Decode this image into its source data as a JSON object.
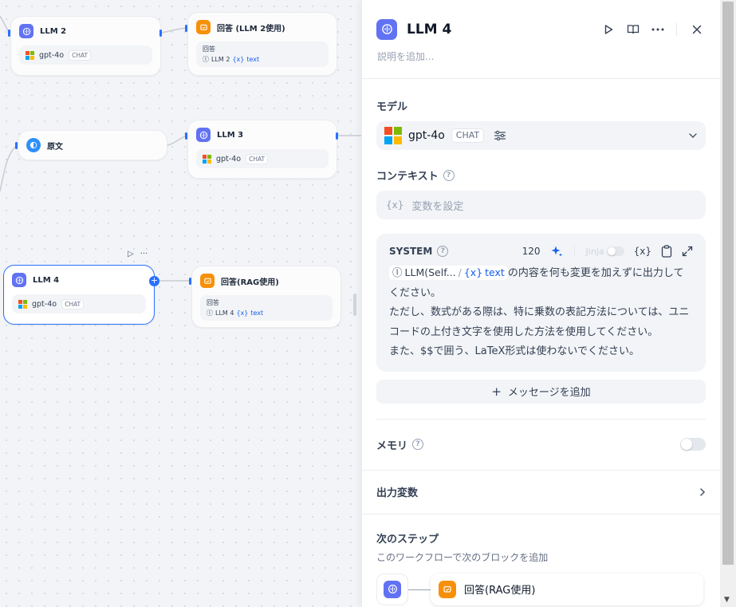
{
  "canvas": {
    "nodes": {
      "llm2": {
        "title": "LLM 2",
        "model": "gpt-4o",
        "mode": "CHAT"
      },
      "answer_llm2": {
        "title": "回答 (LLM 2使用)",
        "label": "回答",
        "ref_node": "LLM 2",
        "ref_var": "text"
      },
      "knowledge": {
        "title": "原文"
      },
      "llm3": {
        "title": "LLM 3",
        "model": "gpt-4o",
        "mode": "CHAT"
      },
      "llm4": {
        "title": "LLM 4",
        "model": "gpt-4o",
        "mode": "CHAT"
      },
      "answer_rag": {
        "title": "回答(RAG使用)",
        "label": "回答",
        "ref_node": "LLM 4",
        "ref_var": "text"
      }
    },
    "node_toolbar": {
      "run": "▷",
      "more": "···"
    }
  },
  "panel": {
    "title": "LLM 4",
    "description_placeholder": "説明を追加...",
    "model_section": {
      "label": "モデル",
      "model": "gpt-4o",
      "mode": "CHAT"
    },
    "context_section": {
      "label": "コンテキスト",
      "placeholder": "変数を設定",
      "var_glyph": "{x}"
    },
    "system": {
      "label": "SYSTEM",
      "count": "120",
      "jinja": "Jinja",
      "var_glyph": "{x}",
      "ref_node": "LLM(Self...",
      "ref_slash": "/",
      "ref_var": "text",
      "line1": "の内容を何も変更を加えずに出力してください。",
      "line2": "ただし、数式がある際は、特に乗数の表記方法については、ユニコードの上付き文字を使用した方法を使用してください。",
      "line3": "また、$$で囲う、LaTeX形式は使わないでください。"
    },
    "add_message": "メッセージを追加",
    "memory": {
      "label": "メモリ"
    },
    "output_vars": {
      "label": "出力変数"
    },
    "next_step": {
      "label": "次のステップ",
      "subtitle": "このワークフローで次のブロックを追加",
      "target": "回答(RAG使用)"
    }
  },
  "colors": {
    "accent": "#2970ff",
    "llm_icon": "#6172f3",
    "answer_icon": "#f79009",
    "knowledge_icon": "#2e90fa"
  }
}
